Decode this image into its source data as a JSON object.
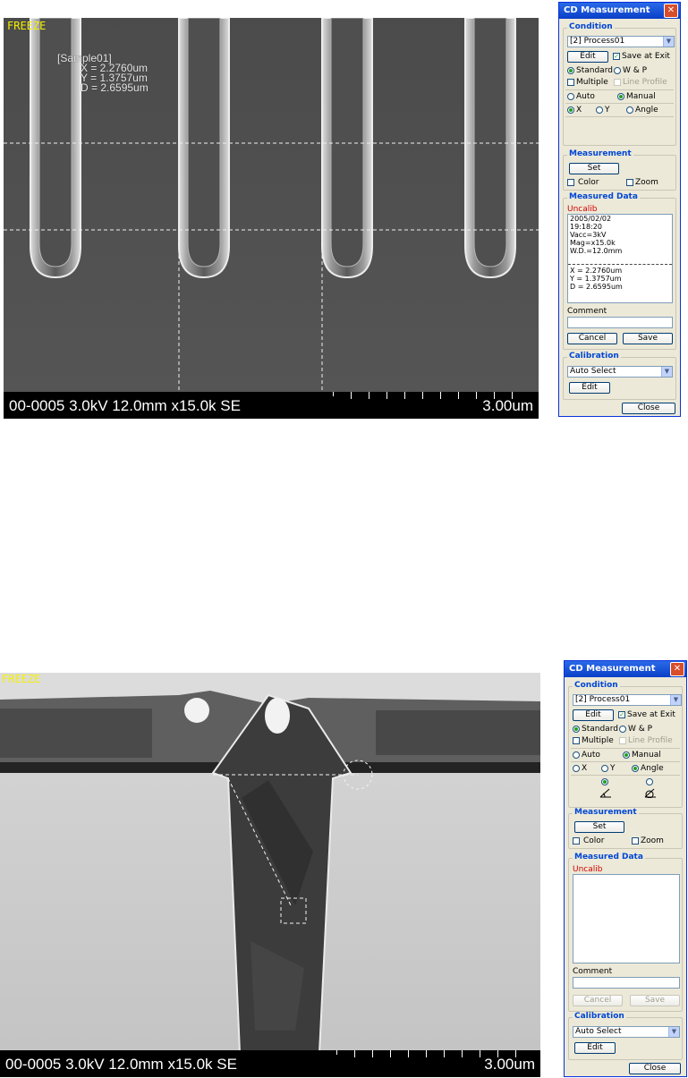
{
  "top_view": {
    "freeze_label": "FREEZE",
    "sample_label": "[Sample01]",
    "readout": {
      "x": "X = 2.2760um",
      "y": "Y = 1.3757um",
      "d": "D = 2.6595um"
    },
    "infobar": {
      "left": "00-0005 3.0kV 12.0mm x15.0k SE",
      "right": "3.00um"
    }
  },
  "bottom_view": {
    "freeze_label": "FREEZE",
    "infobar": {
      "left": "00-0005 3.0kV 12.0mm x15.0k SE",
      "right": "3.00um"
    }
  },
  "dialog_top": {
    "title": "CD Measurement",
    "condition": {
      "label": "Condition",
      "process": "[2] Process01",
      "edit": "Edit",
      "save_at_exit": "Save at Exit",
      "standard": "Standard",
      "wp": "W & P",
      "multiple": "Multiple",
      "line_profile": "Line Profile",
      "auto": "Auto",
      "manual": "Manual",
      "x": "X",
      "y": "Y",
      "angle": "Angle"
    },
    "measurement": {
      "label": "Measurement",
      "set": "Set",
      "color": "Color",
      "zoom": "Zoom"
    },
    "measured_data": {
      "label": "Measured Data",
      "uncalib": "Uncalib",
      "lines": [
        "2005/02/02",
        "19:18:20",
        "Vacc=3kV",
        "Mag=x15.0k",
        "W.D.=12.0mm"
      ],
      "results": [
        "X = 2.2760um",
        "Y = 1.3757um",
        "D = 2.6595um"
      ],
      "comment": "Comment",
      "cancel": "Cancel",
      "save": "Save"
    },
    "calibration": {
      "label": "Calibration",
      "select": "Auto Select",
      "edit": "Edit"
    },
    "close": "Close"
  },
  "dialog_bottom": {
    "title": "CD Measurement",
    "condition": {
      "label": "Condition",
      "process": "[2] Process01",
      "edit": "Edit",
      "save_at_exit": "Save at Exit",
      "standard": "Standard",
      "wp": "W & P",
      "multiple": "Multiple",
      "line_profile": "Line Profile",
      "auto": "Auto",
      "manual": "Manual",
      "x": "X",
      "y": "Y",
      "angle": "Angle"
    },
    "measurement": {
      "label": "Measurement",
      "set": "Set",
      "color": "Color",
      "zoom": "Zoom"
    },
    "measured_data": {
      "label": "Measured Data",
      "uncalib": "Uncalib",
      "comment": "Comment",
      "cancel": "Cancel",
      "save": "Save"
    },
    "calibration": {
      "label": "Calibration",
      "select": "Auto Select",
      "edit": "Edit"
    },
    "close": "Close"
  },
  "colors": {
    "freeze": "#f4f000",
    "group_label": "#0046d5",
    "uncalib": "#d40000",
    "title_bar": "#0a3fc7"
  }
}
